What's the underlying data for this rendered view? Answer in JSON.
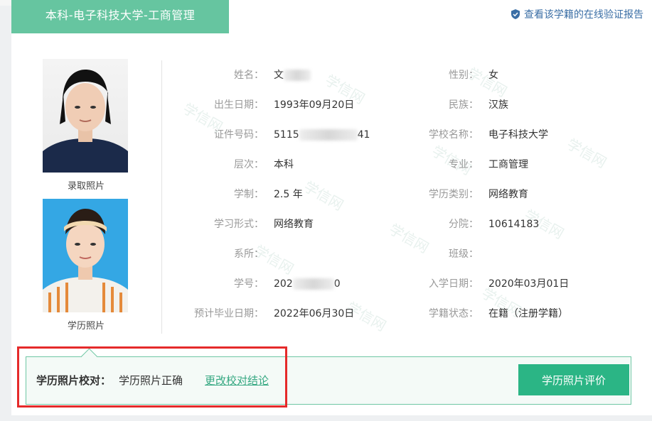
{
  "header": {
    "title": "本科-电子科技大学-工商管理",
    "verify_link": "查看该学籍的在线验证报告"
  },
  "photos": {
    "admission_caption": "录取照片",
    "education_caption": "学历照片"
  },
  "rows": [
    {
      "ll": "姓名：",
      "lv": "文",
      "rl": "性别：",
      "rv": "女"
    },
    {
      "ll": "出生日期：",
      "lv": "1993年09月20日",
      "rl": "民族：",
      "rv": "汉族"
    },
    {
      "ll": "证件号码：",
      "lv": "5115",
      "lv2": "41",
      "rl": "学校名称：",
      "rv": "电子科技大学"
    },
    {
      "ll": "层次：",
      "lv": "本科",
      "rl": "专业：",
      "rv": "工商管理"
    },
    {
      "ll": "学制：",
      "lv": "2.5 年",
      "rl": "学历类别：",
      "rv": "网络教育"
    },
    {
      "ll": "学习形式：",
      "lv": "网络教育",
      "rl": "分院：",
      "rv": "10614183"
    },
    {
      "ll": "系所：",
      "lv": "",
      "rl": "班级：",
      "rv": ""
    },
    {
      "ll": "学号：",
      "lv": "202",
      "lv2": "0",
      "rl": "入学日期：",
      "rv": "2020年03月01日"
    },
    {
      "ll": "预计毕业日期：",
      "lv": "2022年06月30日",
      "rl": "学籍状态：",
      "rv": "在籍（注册学籍）"
    }
  ],
  "photo_check": {
    "label": "学历照片校对：",
    "value": "学历照片正确",
    "change_link": "更改校对结论",
    "evaluate_button": "学历照片评价"
  },
  "watermark_text": "学信网",
  "colors": {
    "accent_green": "#66c5a0",
    "button_green": "#2bb585",
    "link_blue": "#3a6ea5",
    "highlight_red": "#e52a2a"
  }
}
